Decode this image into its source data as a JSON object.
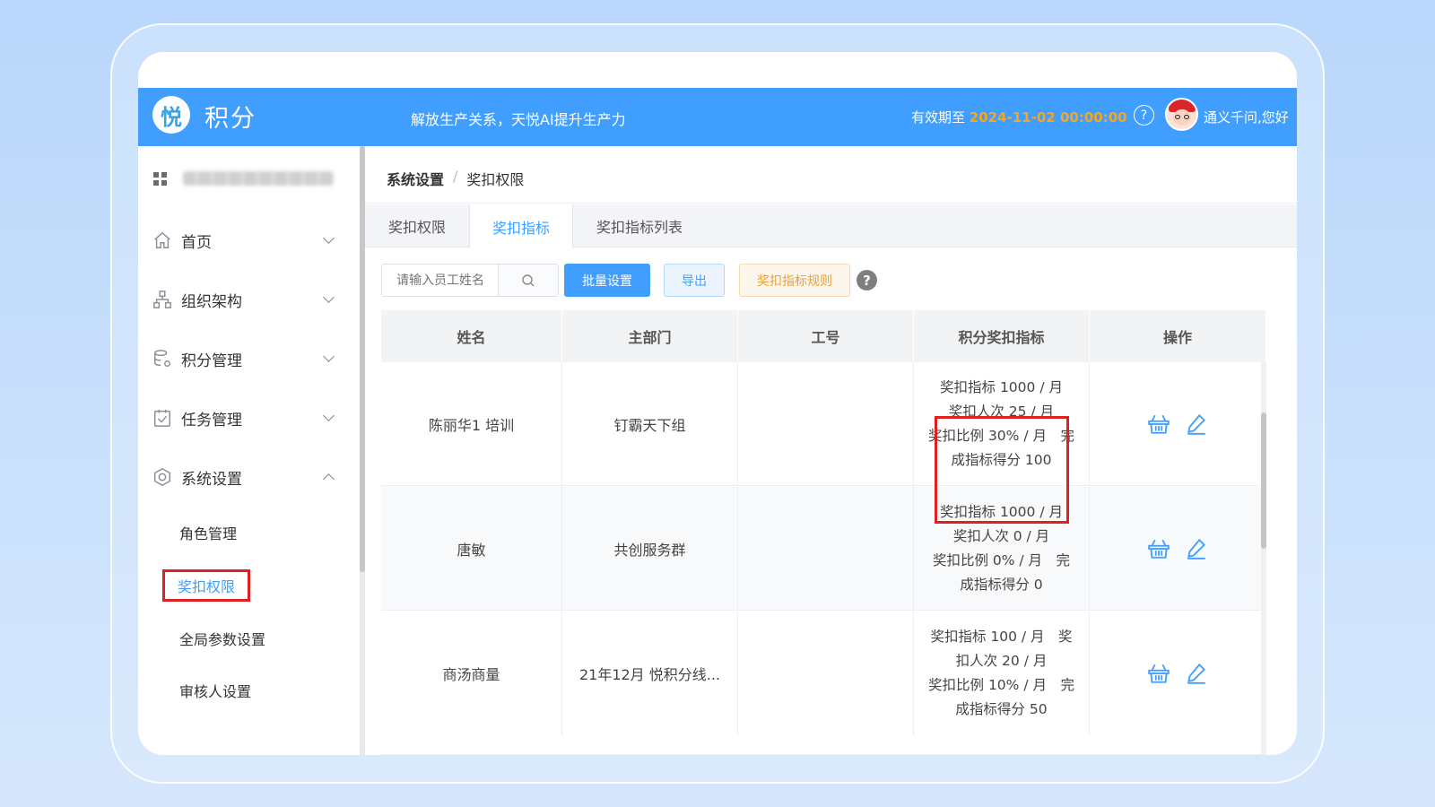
{
  "header": {
    "logo_glyph": "悦",
    "app_title": "积分",
    "slogan": "解放生产关系，天悦AI提升生产力",
    "validity_label": "有效期至",
    "validity_date": "2024-11-02 00:00:00",
    "help_glyph": "?",
    "username": "通义千问,您好",
    "accent_color": "#409eff",
    "date_color": "#f5a623"
  },
  "sidebar": {
    "menu": [
      {
        "label": "首页",
        "icon": "home-icon",
        "expanded": false
      },
      {
        "label": "组织架构",
        "icon": "org-chart-icon",
        "expanded": false
      },
      {
        "label": "积分管理",
        "icon": "database-gear-icon",
        "expanded": false
      },
      {
        "label": "任务管理",
        "icon": "clipboard-check-icon",
        "expanded": false
      },
      {
        "label": "系统设置",
        "icon": "settings-hex-icon",
        "expanded": true
      }
    ],
    "submenu": [
      {
        "label": "角色管理",
        "active": false
      },
      {
        "label": "奖扣权限",
        "active": true
      },
      {
        "label": "全局参数设置",
        "active": false
      },
      {
        "label": "审核人设置",
        "active": false
      }
    ]
  },
  "breadcrumb": {
    "parent": "系统设置",
    "separator": "/",
    "current": "奖扣权限"
  },
  "tabs": [
    {
      "label": "奖扣权限",
      "active": false
    },
    {
      "label": "奖扣指标",
      "active": true
    },
    {
      "label": "奖扣指标列表",
      "active": false
    }
  ],
  "toolbar": {
    "search_placeholder": "请输入员工姓名",
    "batch_label": "批量设置",
    "export_label": "导出",
    "rules_label": "奖扣指标规则",
    "help_glyph": "?"
  },
  "table": {
    "headers": [
      "姓名",
      "主部门",
      "工号",
      "积分奖扣指标",
      "操作"
    ],
    "rows": [
      {
        "name": "陈丽华1 培训",
        "dept": "钉霸天下组",
        "emp_no": "",
        "metric": [
          "奖扣指标 1000 / 月",
          "奖扣人次 25 / 月",
          "奖扣比例 30% / 月　完",
          "成指标得分 100"
        ]
      },
      {
        "name": "唐敏",
        "dept": "共创服务群",
        "emp_no": "",
        "metric": [
          "奖扣指标 1000 / 月",
          "奖扣人次 0 / 月",
          "奖扣比例 0% / 月　完",
          "成指标得分 0"
        ]
      },
      {
        "name": "商汤商量",
        "dept": "21年12月 悦积分线...",
        "emp_no": "",
        "metric": [
          "奖扣指标 100 / 月　奖",
          "扣人次 20 / 月",
          "奖扣比例 10% / 月　完",
          "成指标得分 50"
        ]
      }
    ]
  }
}
